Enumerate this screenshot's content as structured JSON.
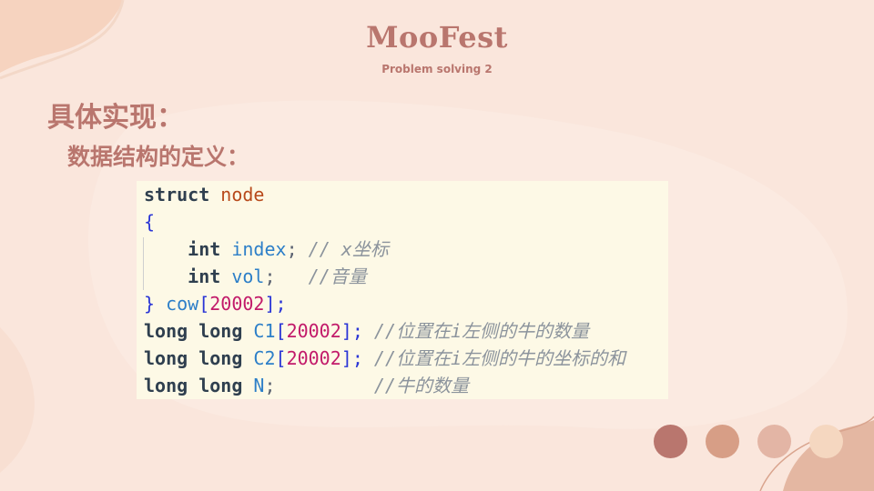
{
  "slide": {
    "title": "MooFest",
    "subtitle": "Problem solving 2",
    "heading": "具体实现：",
    "subheading": "数据结构的定义："
  },
  "code": {
    "line1": {
      "kw": "struct",
      "name": "node"
    },
    "line2": {
      "brace": "{"
    },
    "line3": {
      "type": "int",
      "ident": "index",
      "punct": ";",
      "comment": "// x坐标"
    },
    "line4": {
      "type": "int",
      "ident": "vol",
      "punct": ";",
      "comment": "//音量"
    },
    "line5": {
      "brace": "}",
      "ident": "cow",
      "open": "[",
      "num": "20002",
      "close": "];"
    },
    "line6": {
      "type": "long long",
      "ident": "C1",
      "open": "[",
      "num": "20002",
      "close": "];",
      "comment": "//位置在i左侧的牛的数量"
    },
    "line7": {
      "type": "long long",
      "ident": "C2",
      "open": "[",
      "num": "20002",
      "close": "];",
      "comment": "//位置在i左侧的牛的坐标的和"
    },
    "line8": {
      "type": "long long",
      "ident": "N",
      "punct": ";",
      "comment": "//牛的数量"
    }
  },
  "colors": {
    "background": "#fae6dc",
    "accent": "#b9766e",
    "code_background": "#fdf9e6",
    "dot1": "#b9766e",
    "dot2": "#d79e86",
    "dot3": "#e3b5a5",
    "dot4": "#f5d7c0"
  }
}
